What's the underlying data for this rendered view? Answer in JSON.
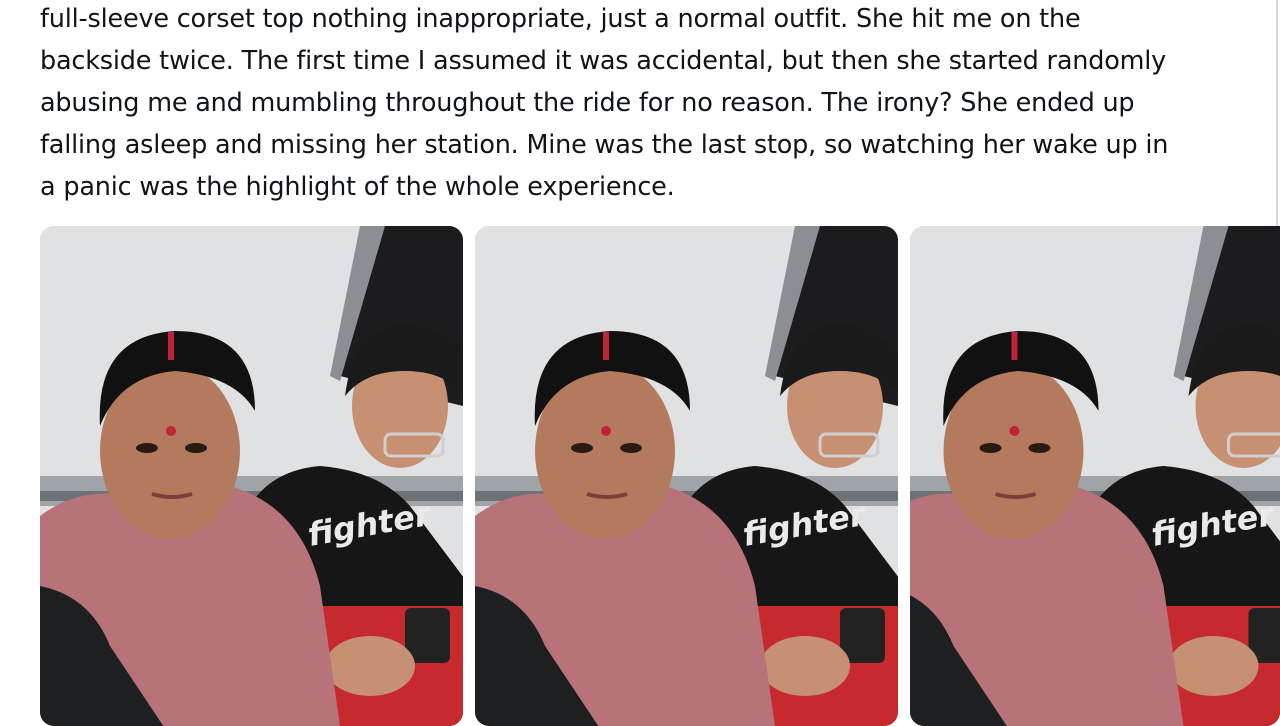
{
  "post": {
    "lines": [
      "full-sleeve corset top nothing inappropriate, just a normal outfit. She hit me on the",
      "backside twice. The first time I assumed it was accidental, but then she started randomly",
      "abusing me and mumbling throughout the ride for no reason. The irony? She ended up",
      "falling asleep and missing her station. Mine was the last stop, so watching her wake up in",
      "a panic was the highlight of the whole experience."
    ]
  },
  "media": {
    "photos": [
      {
        "shirt_text": "fighter"
      },
      {
        "shirt_text": "fighter"
      },
      {
        "shirt_text": "fighter"
      }
    ]
  },
  "colors": {
    "text": "#0f1419",
    "border": "#cfd9de",
    "saree": "#b8727a",
    "tshirt": "#161616",
    "bag": "#c62a2c",
    "train_wall": "#dfe1e2"
  }
}
